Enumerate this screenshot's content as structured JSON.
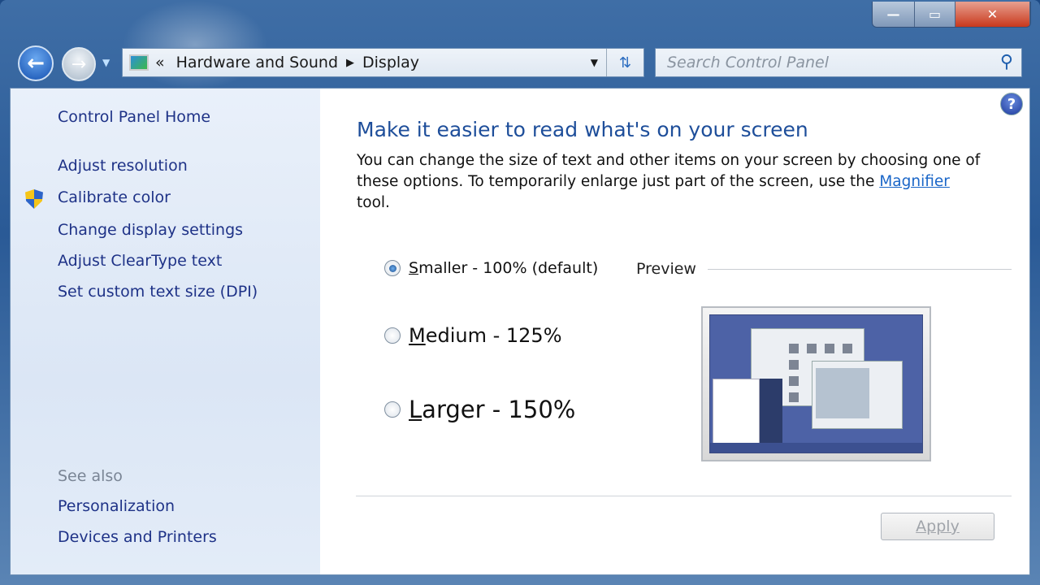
{
  "window": {
    "minimize": "—",
    "maximize": "▭",
    "close": "✕"
  },
  "address": {
    "overflow": "«",
    "crumbs": [
      "Hardware and Sound",
      "Display"
    ],
    "separator": "▶",
    "dropdown": "▼",
    "refresh": "⇅"
  },
  "search": {
    "placeholder": "Search Control Panel",
    "icon": "search-icon"
  },
  "sidebar": {
    "home": "Control Panel Home",
    "links": [
      "Adjust resolution",
      "Calibrate color",
      "Change display settings",
      "Adjust ClearType text",
      "Set custom text size (DPI)"
    ],
    "see_also": "See also",
    "also_links": [
      "Personalization",
      "Devices and Printers"
    ]
  },
  "main": {
    "help": "?",
    "title": "Make it easier to read what's on your screen",
    "desc_part1": "You can change the size of text and other items on your screen by choosing one of these options. To temporarily enlarge just part of the screen, use the ",
    "desc_link": "Magnifier",
    "desc_part2": " tool.",
    "options": [
      {
        "key": "S",
        "rest": "maller - 100% (default)",
        "selected": true
      },
      {
        "key": "M",
        "rest": "edium - 125%",
        "selected": false
      },
      {
        "key": "L",
        "rest": "arger - 150%",
        "selected": false
      }
    ],
    "preview_label": "Preview",
    "apply": "Apply"
  },
  "colors": {
    "link": "#1e3287",
    "title": "#1e4e9a",
    "hyperlink": "#1a66c8"
  }
}
